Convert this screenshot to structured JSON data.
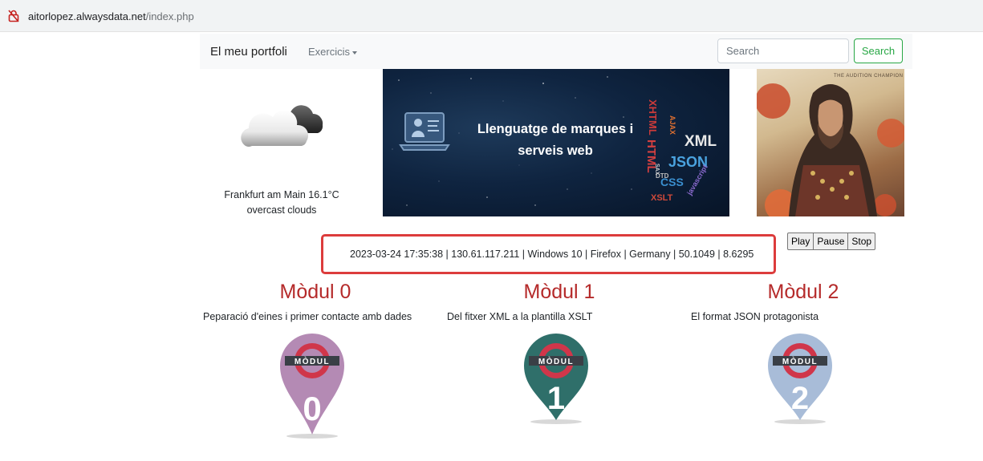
{
  "browser": {
    "url_domain": "aitorlopez.alwaysdata.net",
    "url_path": "/index.php"
  },
  "navbar": {
    "brand": "El meu portfoli",
    "dropdown_label": "Exercicis",
    "search_placeholder": "Search",
    "search_button": "Search"
  },
  "weather": {
    "icon": "cloud-icon",
    "location_temp": "Frankfurt am Main 16.1°C",
    "description": "overcast clouds"
  },
  "banner": {
    "line1": "Llenguatge de marques i",
    "line2": "serveis web",
    "tags": [
      "XHTML",
      "XML",
      "HTML",
      "JSON",
      "CSS",
      "XSLT",
      "AJAX",
      "DTD",
      "javascript",
      "SAX"
    ]
  },
  "album": {
    "caption": "THE AUDITION   CHAMPION"
  },
  "media": {
    "play": "Play",
    "pause": "Pause",
    "stop": "Stop"
  },
  "info": {
    "text": "2023-03-24 17:35:38 | 130.61.117.211 | Windows 10 | Firefox | Germany | 50.1049 | 8.6295"
  },
  "modules": [
    {
      "title": "Mòdul 0",
      "description": "Peparació d'eines i primer contacte amb dades",
      "badge_label": "MÒDUL",
      "badge_number": "0",
      "color": "#b48ab4"
    },
    {
      "title": "Mòdul 1",
      "description": "Del fitxer XML a la plantilla XSLT",
      "badge_label": "MÒDUL",
      "badge_number": "1",
      "color": "#2f6f6a"
    },
    {
      "title": "Mòdul 2",
      "description": "El format JSON protagonista",
      "badge_label": "MÒDUL",
      "badge_number": "2",
      "color": "#a8bcd8"
    }
  ]
}
